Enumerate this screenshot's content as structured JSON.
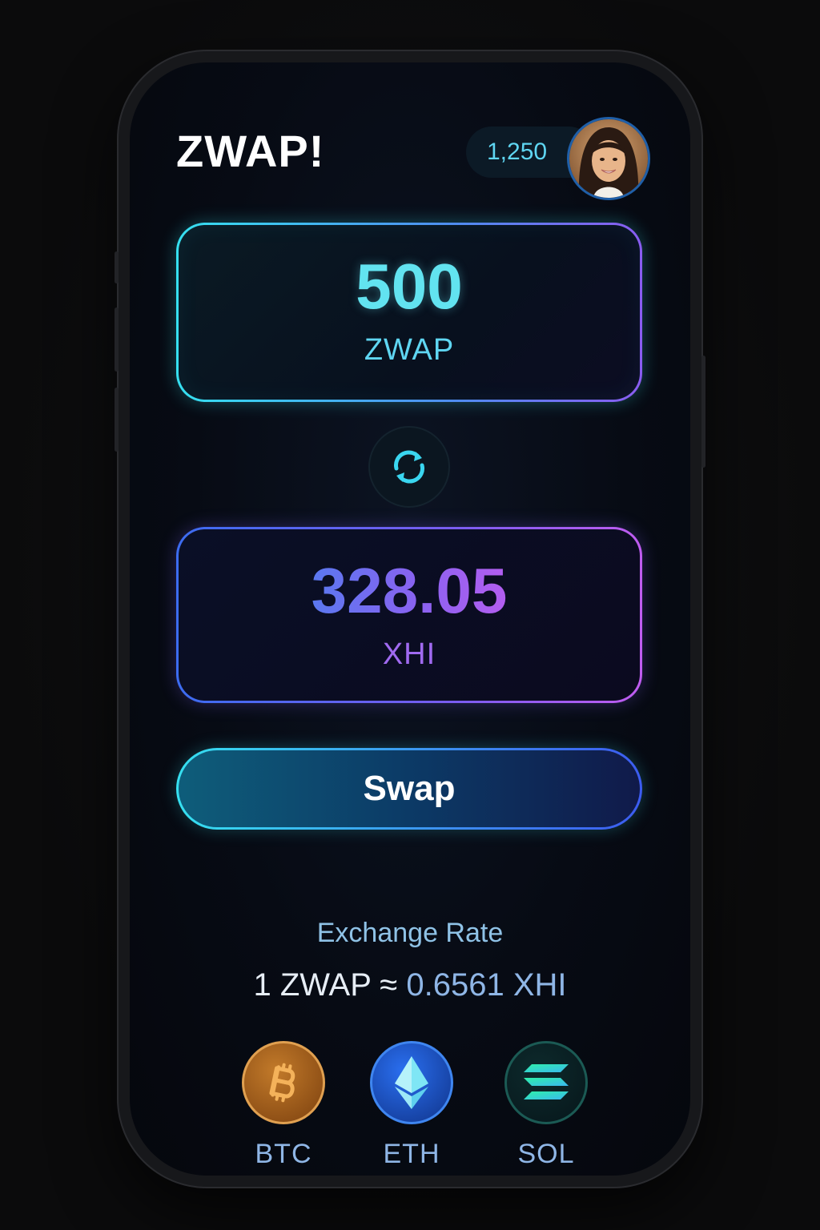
{
  "header": {
    "app_title": "ZWAP!",
    "balance": "1,250"
  },
  "swap": {
    "from_amount": "500",
    "from_unit": "ZWAP",
    "to_amount": "328.05",
    "to_unit": "XHI",
    "button_label": "Swap"
  },
  "rate": {
    "label": "Exchange Rate",
    "lhs": "1 ZWAP",
    "approx": "≈",
    "rhs": "0.6561 XHI"
  },
  "coins": [
    {
      "symbol": "BTC",
      "icon": "bitcoin-icon",
      "color": "#c27a2a"
    },
    {
      "symbol": "ETH",
      "icon": "ethereum-icon",
      "color": "#2a6ff0"
    },
    {
      "symbol": "SOL",
      "icon": "solana-icon",
      "color": "#2ee6b0"
    }
  ],
  "colors": {
    "accent_cyan": "#36e0f0",
    "accent_purple": "#8a5cf0",
    "background": "#070b14"
  }
}
